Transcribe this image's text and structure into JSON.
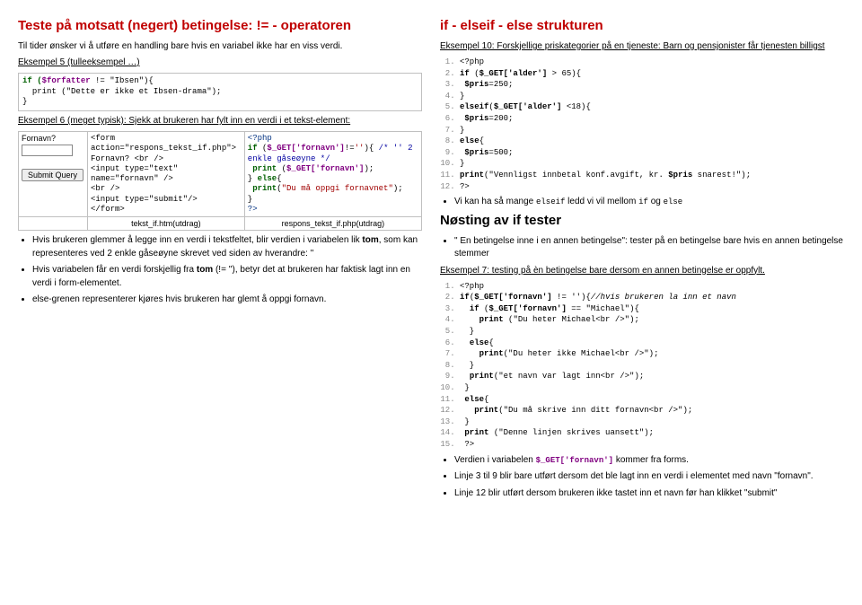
{
  "left": {
    "h_negert": "Teste på motsatt (negert) betingelse: != - operatoren",
    "intro": "Til tider ønsker vi å utføre en handling bare hvis en variabel ikke har en viss verdi.",
    "eks5": "Eksempel 5 (tulleeksempel …)",
    "code5_l1_a": "if (",
    "code5_l1_var": "$forfatter",
    "code5_l1_b": " != \"Ibsen\"){",
    "code5_l2": "  print (\"Dette er ikke et Ibsen-drama\");",
    "code5_l3": "}",
    "eks6": "Eksempel 6 (meget typisk): Sjekk at brukeren har fylt inn en verdi i et tekst-element:",
    "ex6_form_label": "Fornavn?",
    "ex6_submit": "Submit Query",
    "ex6_mid": "<form\naction=\"respons_tekst_if.php\">\nFornavn? <br />\n<input type=\"text\"\nname=\"fornavn\" />\n<br />\n<input type=\"submit\"/>\n</form>",
    "ex6_right": "<?php\nif ($_GET['fornavn']!=''){ /* '' 2\nenkle gåseøyne */\n print ($_GET['fornavn']);\n} else{\n print(\"Du må oppgi fornavnet\");\n}\n?>",
    "ex6_foot_mid": "tekst_if.htm(utdrag)",
    "ex6_foot_right": "respons_tekst_if.php(utdrag)",
    "bul1_a": "Hvis brukeren glemmer å legge inn en verdi i tekstfeltet, blir verdien i variabelen lik ",
    "bul1_b": "tom",
    "bul1_c": ", som kan representeres ved 2 enkle gåseøyne skrevet ved siden av hverandre: ''",
    "bul2_a": "Hvis variabelen får en verdi forskjellig fra ",
    "bul2_b": "tom",
    "bul2_c": " (!= ''), betyr det at brukeren har faktisk lagt inn en verdi i form-elementet.",
    "bul3": "else-grenen representerer kjøres hvis brukeren har glemt å oppgi fornavn."
  },
  "right": {
    "h_ifelse": "if - elseif - else strukturen",
    "eks10": "Eksempel 10: Forskjellige priskategorier på en tjeneste: Barn og pensjonister får tjenesten billigst",
    "code10": [
      "<?php",
      "if ($_GET['alder'] > 65){",
      " $pris=250;",
      "}",
      "elseif($_GET['alder'] <18){",
      " $pris=200;",
      "}",
      "else{",
      " $pris=500;",
      "}",
      "print(\"Vennligst innbetal konf.avgift, kr. $pris snarest!\");",
      "?>"
    ],
    "bul_r1_a": "Vi kan ha så mange ",
    "bul_r1_b": "elseif",
    "bul_r1_c": " ledd vi vil mellom ",
    "bul_r1_d": "if",
    "bul_r1_e": " og ",
    "bul_r1_f": "else",
    "h_nost": "Nøsting av if tester",
    "bul_n": "\" En betingelse inne i en annen betingelse\": tester på en betingelse bare hvis en annen betingelse stemmer",
    "eks7": "Eksempel 7: testing på èn betingelse bare dersom en annen betingelse er oppfylt.",
    "code7": [
      "<?php",
      "if($_GET['fornavn'] != ''){//hvis brukeren la inn et navn",
      "  if ($_GET['fornavn'] == \"Michael\"){",
      "    print (\"Du heter Michael<br />\");",
      "  }",
      "  else{",
      "    print(\"Du heter ikke Michael<br />\");",
      "  }",
      "  print(\"et navn var lagt inn<br />\");",
      " }",
      " else{",
      "   print(\"Du må skrive inn ditt fornavn<br />\");",
      " }",
      " print (\"Denne linjen skrives uansett\");",
      " ?>"
    ],
    "bul_b1_a": "Verdien i variabelen ",
    "bul_b1_b": "$_GET['fornavn']",
    "bul_b1_c": " kommer fra forms.",
    "bul_b2": "Linje 3 til 9 blir bare utført dersom det ble lagt inn en verdi i elementet med navn \"fornavn\".",
    "bul_b3": "Linje 12 blir utført dersom brukeren ikke tastet inn et navn før han klikket \"submit\""
  }
}
